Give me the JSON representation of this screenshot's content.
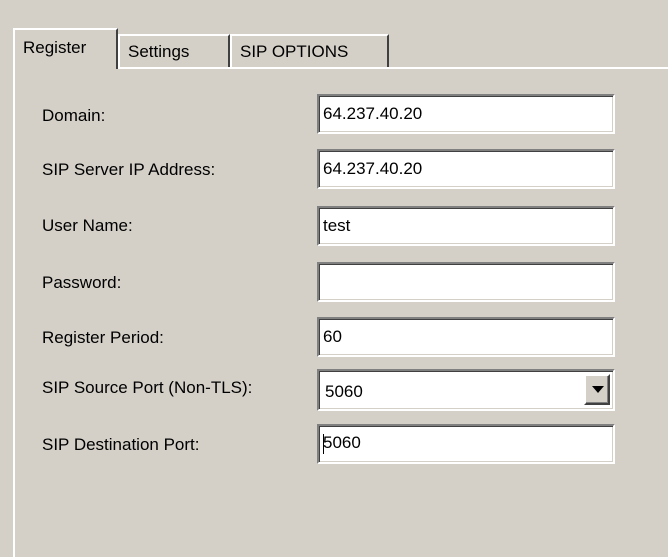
{
  "tabs": [
    {
      "label": "Register",
      "active": true
    },
    {
      "label": "Settings",
      "active": false
    },
    {
      "label": "SIP OPTIONS",
      "active": false
    }
  ],
  "form": {
    "domain": {
      "label": "Domain:",
      "value": "64.237.40.20"
    },
    "sip_server_ip": {
      "label": "SIP Server IP Address:",
      "value": "64.237.40.20"
    },
    "user_name": {
      "label": "User Name:",
      "value": "test"
    },
    "password": {
      "label": "Password:",
      "value": ""
    },
    "register_period": {
      "label": "Register Period:",
      "value": "60"
    },
    "sip_source_port": {
      "label": "SIP Source Port (Non-TLS):",
      "value": "5060"
    },
    "sip_destination_port": {
      "label": "SIP Destination Port:",
      "value": "5060"
    }
  },
  "icons": {
    "dropdown": "chevron-down-icon"
  },
  "colors": {
    "face": "#d4d0c8",
    "field_bg": "#ffffff",
    "shadow": "#808080",
    "highlight": "#ffffff"
  }
}
